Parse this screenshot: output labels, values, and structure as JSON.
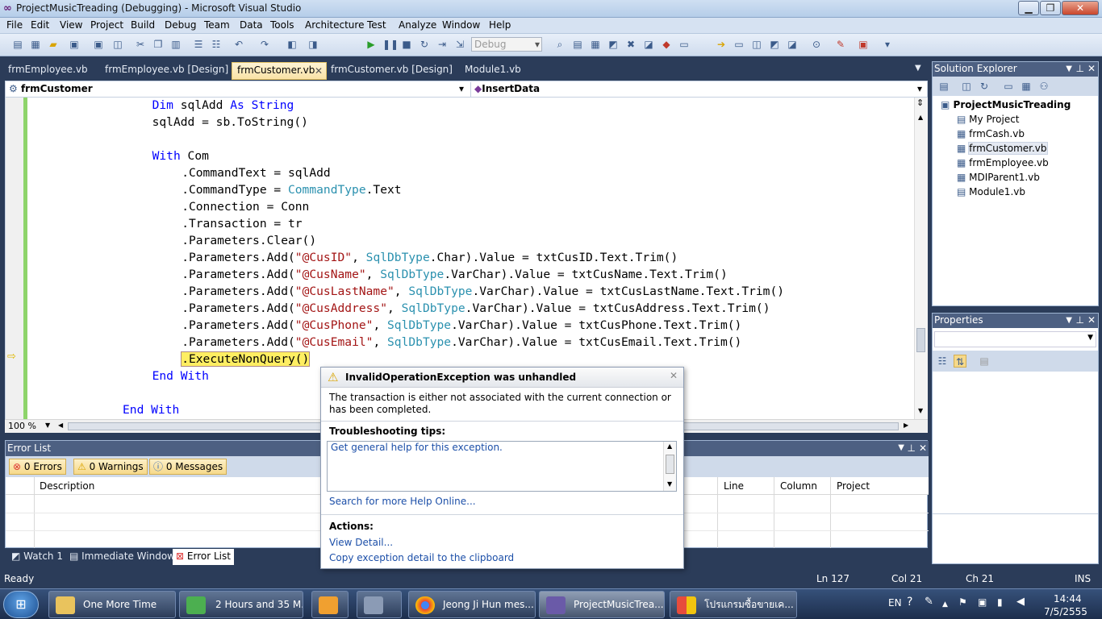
{
  "window": {
    "title": "ProjectMusicTreading (Debugging) - Microsoft Visual Studio",
    "min": "▁",
    "max": "❐",
    "close": "✕"
  },
  "menu": [
    "File",
    "Edit",
    "View",
    "Project",
    "Build",
    "Debug",
    "Team",
    "Data",
    "Tools",
    "Architecture",
    "Test",
    "Analyze",
    "Window",
    "Help"
  ],
  "toolbar": {
    "config": "Debug"
  },
  "tabs": [
    {
      "label": "frmEmployee.vb"
    },
    {
      "label": "frmEmployee.vb [Design]"
    },
    {
      "label": "frmCustomer.vb"
    },
    {
      "label": "frmCustomer.vb [Design]"
    },
    {
      "label": "Module1.vb"
    }
  ],
  "tab_close": "✕",
  "nav": {
    "class_combo": "frmCustomer",
    "method_combo": "InsertData"
  },
  "code_lines": [
    {
      "indent": 4,
      "parts": [
        [
          "kw",
          "Dim"
        ],
        [
          "",
          "sqlAdd "
        ],
        [
          "kw",
          "As String"
        ]
      ]
    },
    {
      "indent": 4,
      "parts": [
        [
          "",
          "sqlAdd = sb.ToString()"
        ]
      ]
    },
    {
      "indent": 4,
      "parts": [
        [
          "",
          ""
        ]
      ]
    },
    {
      "indent": 4,
      "parts": [
        [
          "kw",
          "With"
        ],
        [
          "",
          " Com"
        ]
      ]
    },
    {
      "indent": 5,
      "parts": [
        [
          "",
          ".CommandText = sqlAdd"
        ]
      ]
    },
    {
      "indent": 5,
      "parts": [
        [
          "",
          ".CommandType = "
        ],
        [
          "ty",
          "CommandType"
        ],
        [
          "",
          ".Text"
        ]
      ]
    },
    {
      "indent": 5,
      "parts": [
        [
          "",
          ".Connection = Conn"
        ]
      ]
    },
    {
      "indent": 5,
      "parts": [
        [
          "",
          ".Transaction = tr"
        ]
      ]
    },
    {
      "indent": 5,
      "parts": [
        [
          "",
          ".Parameters.Clear()"
        ]
      ]
    },
    {
      "indent": 5,
      "parts": [
        [
          "",
          ".Parameters.Add("
        ],
        [
          "st",
          "\"@CusID\""
        ],
        [
          "",
          ", "
        ],
        [
          "ty",
          "SqlDbType"
        ],
        [
          "",
          ".Char).Value = txtCusID.Text.Trim()"
        ]
      ]
    },
    {
      "indent": 5,
      "parts": [
        [
          "",
          ".Parameters.Add("
        ],
        [
          "st",
          "\"@CusName\""
        ],
        [
          "",
          ", "
        ],
        [
          "ty",
          "SqlDbType"
        ],
        [
          "",
          ".VarChar).Value = txtCusName.Text.Trim()"
        ]
      ]
    },
    {
      "indent": 5,
      "parts": [
        [
          "",
          ".Parameters.Add("
        ],
        [
          "st",
          "\"@CusLastName\""
        ],
        [
          "",
          ", "
        ],
        [
          "ty",
          "SqlDbType"
        ],
        [
          "",
          ".VarChar).Value = txtCusLastName.Text.Trim()"
        ]
      ]
    },
    {
      "indent": 5,
      "parts": [
        [
          "",
          ".Parameters.Add("
        ],
        [
          "st",
          "\"@CusAddress\""
        ],
        [
          "",
          ", "
        ],
        [
          "ty",
          "SqlDbType"
        ],
        [
          "",
          ".VarChar).Value = txtCusAddress.Text.Trim()"
        ]
      ]
    },
    {
      "indent": 5,
      "parts": [
        [
          "",
          ".Parameters.Add("
        ],
        [
          "st",
          "\"@CusPhone\""
        ],
        [
          "",
          ", "
        ],
        [
          "ty",
          "SqlDbType"
        ],
        [
          "",
          ".VarChar).Value = txtCusPhone.Text.Trim()"
        ]
      ]
    },
    {
      "indent": 5,
      "parts": [
        [
          "",
          ".Parameters.Add("
        ],
        [
          "st",
          "\"@CusEmail\""
        ],
        [
          "",
          ", "
        ],
        [
          "ty",
          "SqlDbType"
        ],
        [
          "",
          ".VarChar).Value = txtCusEmail.Text.Trim()"
        ]
      ]
    },
    {
      "indent": 5,
      "parts": [
        [
          "hl",
          ".ExecuteNonQuery()"
        ]
      ]
    },
    {
      "indent": 4,
      "parts": [
        [
          "kw",
          "End With"
        ]
      ]
    },
    {
      "indent": 4,
      "parts": [
        [
          "",
          ""
        ]
      ]
    },
    {
      "indent": 3,
      "parts": [
        [
          "kw",
          "End With"
        ]
      ]
    }
  ],
  "zoom": "100 %",
  "exception": {
    "title": "InvalidOperationException was unhandled",
    "message": "The transaction is either not associated with the current connection or has been completed.",
    "tips_heading": "Troubleshooting tips:",
    "tip_link": "Get general help for this exception.",
    "search_link": "Search for more Help Online...",
    "actions_heading": "Actions:",
    "view_detail": "View Detail...",
    "copy_detail": "Copy exception detail to the clipboard",
    "close": "✕"
  },
  "error_list": {
    "title": "Error List",
    "errors": "0 Errors",
    "warnings": "0 Warnings",
    "messages": "0 Messages",
    "columns": [
      "Description",
      "Line",
      "Column",
      "Project"
    ]
  },
  "bottom_tabs": [
    "Watch 1",
    "Immediate Window",
    "Error List"
  ],
  "status": {
    "ready": "Ready",
    "ln": "Ln 127",
    "col": "Col 21",
    "ch": "Ch 21",
    "ins": "INS"
  },
  "solution_explorer": {
    "title": "Solution Explorer",
    "project": "ProjectMusicTreading",
    "items": [
      "My Project",
      "frmCash.vb",
      "frmCustomer.vb",
      "frmEmployee.vb",
      "MDIParent1.vb",
      "Module1.vb"
    ]
  },
  "properties": {
    "title": "Properties"
  },
  "taskbar": {
    "items": [
      {
        "label": "One More Time"
      },
      {
        "label": "2 Hours and 35 M..."
      },
      {
        "label": ""
      },
      {
        "label": ""
      },
      {
        "label": "Jeong Ji Hun mes..."
      },
      {
        "label": "ProjectMusicTrea..."
      },
      {
        "label": "โปรแกรมซื้อขายเค..."
      }
    ],
    "lang": "EN",
    "time": "14:44",
    "date": "7/5/2555"
  }
}
